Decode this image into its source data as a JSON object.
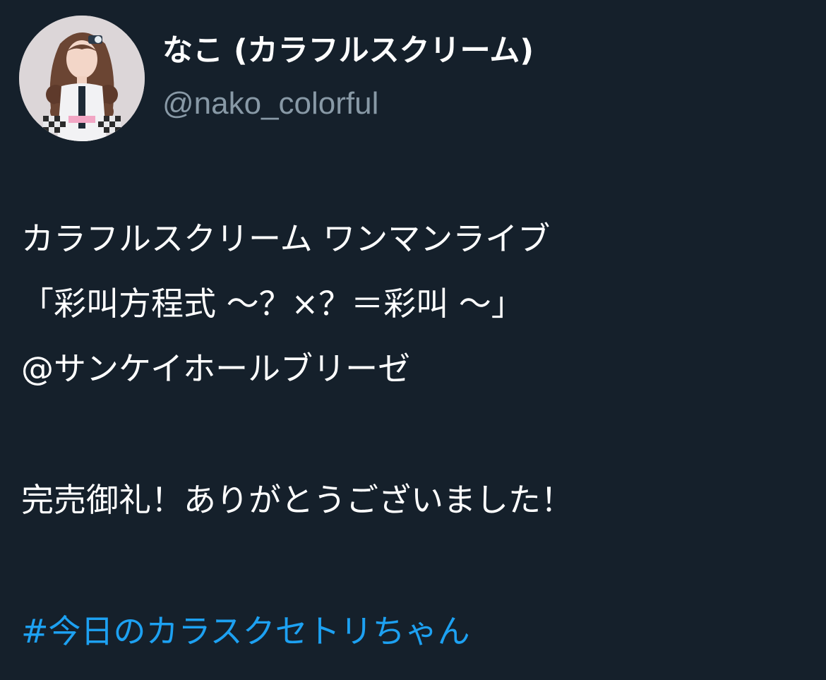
{
  "author": {
    "display_name": "なこ (カラフルスクリーム)",
    "handle": "@nako_colorful",
    "avatar_icon": "profile-photo"
  },
  "tweet": {
    "lines": [
      "カラフルスクリーム ワンマンライブ",
      "「彩叫方程式 〜？×？＝彩叫 〜」",
      "@サンケイホールブリーゼ",
      "完売御礼！ありがとうございました！"
    ],
    "hashtag": "#今日のカラスクセトリちゃん"
  },
  "colors": {
    "background": "#15202b",
    "text": "#ffffff",
    "secondary_text": "#8899a6",
    "link": "#1da1f2"
  }
}
